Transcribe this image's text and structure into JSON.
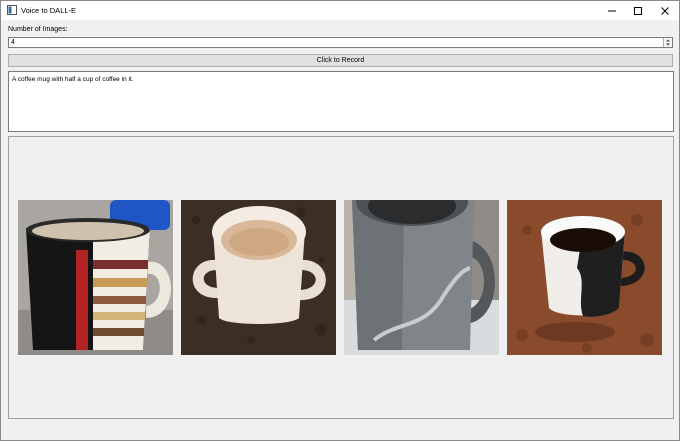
{
  "window": {
    "title": "Voice to DALL-E"
  },
  "form": {
    "num_images_label": "Number of Images:",
    "num_images_value": "4",
    "record_button_label": "Click to Record",
    "prompt_text": "A coffee mug with half a cup of coffee in it."
  },
  "images": [
    {
      "name": "generated-image-1",
      "subject": "black and striped coffee mug"
    },
    {
      "name": "generated-image-2",
      "subject": "white two-handled mug with milky coffee"
    },
    {
      "name": "generated-image-3",
      "subject": "grey mug with coffee drip"
    },
    {
      "name": "generated-image-4",
      "subject": "white and black mug with black coffee"
    }
  ],
  "icons": {
    "app": "app-window-icon",
    "minimize": "minimize-icon",
    "maximize": "maximize-icon",
    "close": "close-icon",
    "spin_up": "chevron-up-icon",
    "spin_down": "chevron-down-icon"
  }
}
